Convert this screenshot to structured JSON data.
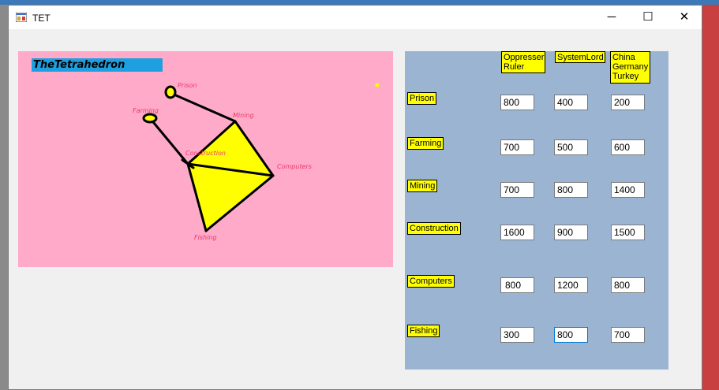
{
  "window": {
    "title": "TET",
    "minimize_glyph": "─",
    "maximize_glyph": "☐",
    "close_glyph": "✕"
  },
  "canvas": {
    "logo_text": "TheTetrahedron",
    "nodes": {
      "prison": "Prison",
      "farming": "Farming",
      "mining": "Mining",
      "construction": "Construction",
      "computers": "Computers",
      "fishing": "Fishing"
    }
  },
  "columns": [
    "Oppresser Ruler",
    "SystemLord",
    "China Germany Turkey"
  ],
  "rows": [
    {
      "label": "Prison",
      "values": [
        "800",
        "400",
        "200"
      ]
    },
    {
      "label": "Farming",
      "values": [
        "700",
        "500",
        "600"
      ]
    },
    {
      "label": "Mining",
      "values": [
        "700",
        "800",
        "1400"
      ]
    },
    {
      "label": "Construction",
      "values": [
        "1600",
        "900",
        "1500"
      ]
    },
    {
      "label": "Computers",
      "values": [
        "800",
        "1200",
        "800"
      ]
    },
    {
      "label": "Fishing",
      "values": [
        "300",
        "800",
        "700"
      ]
    }
  ],
  "colors": {
    "canvas_bg": "#ffaac8",
    "panel_bg": "#9ab4d2",
    "label_bg": "#ffff00",
    "logo_bg": "#1e9fe0"
  }
}
